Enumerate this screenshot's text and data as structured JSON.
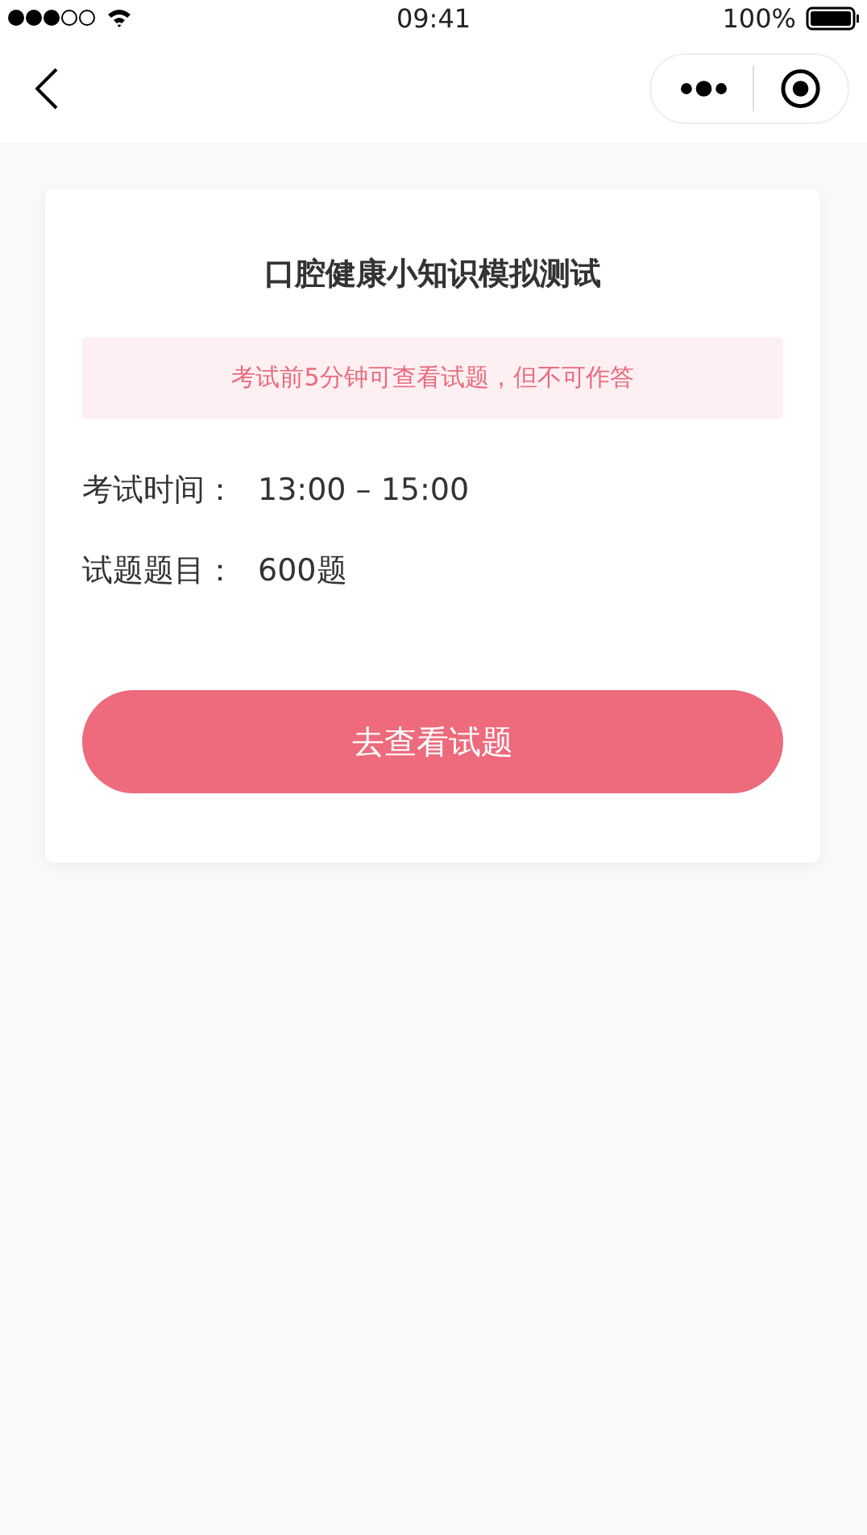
{
  "status_bar": {
    "time": "09:41",
    "battery": "100%"
  },
  "card": {
    "title": "口腔健康小知识模拟测试",
    "notice": "考试前5分钟可查看试题，但不可作答",
    "rows": [
      {
        "label": "考试时间：",
        "value": "13:00 – 15:00"
      },
      {
        "label": "试题题目：",
        "value": "600题"
      }
    ],
    "button": "去查看试题"
  }
}
